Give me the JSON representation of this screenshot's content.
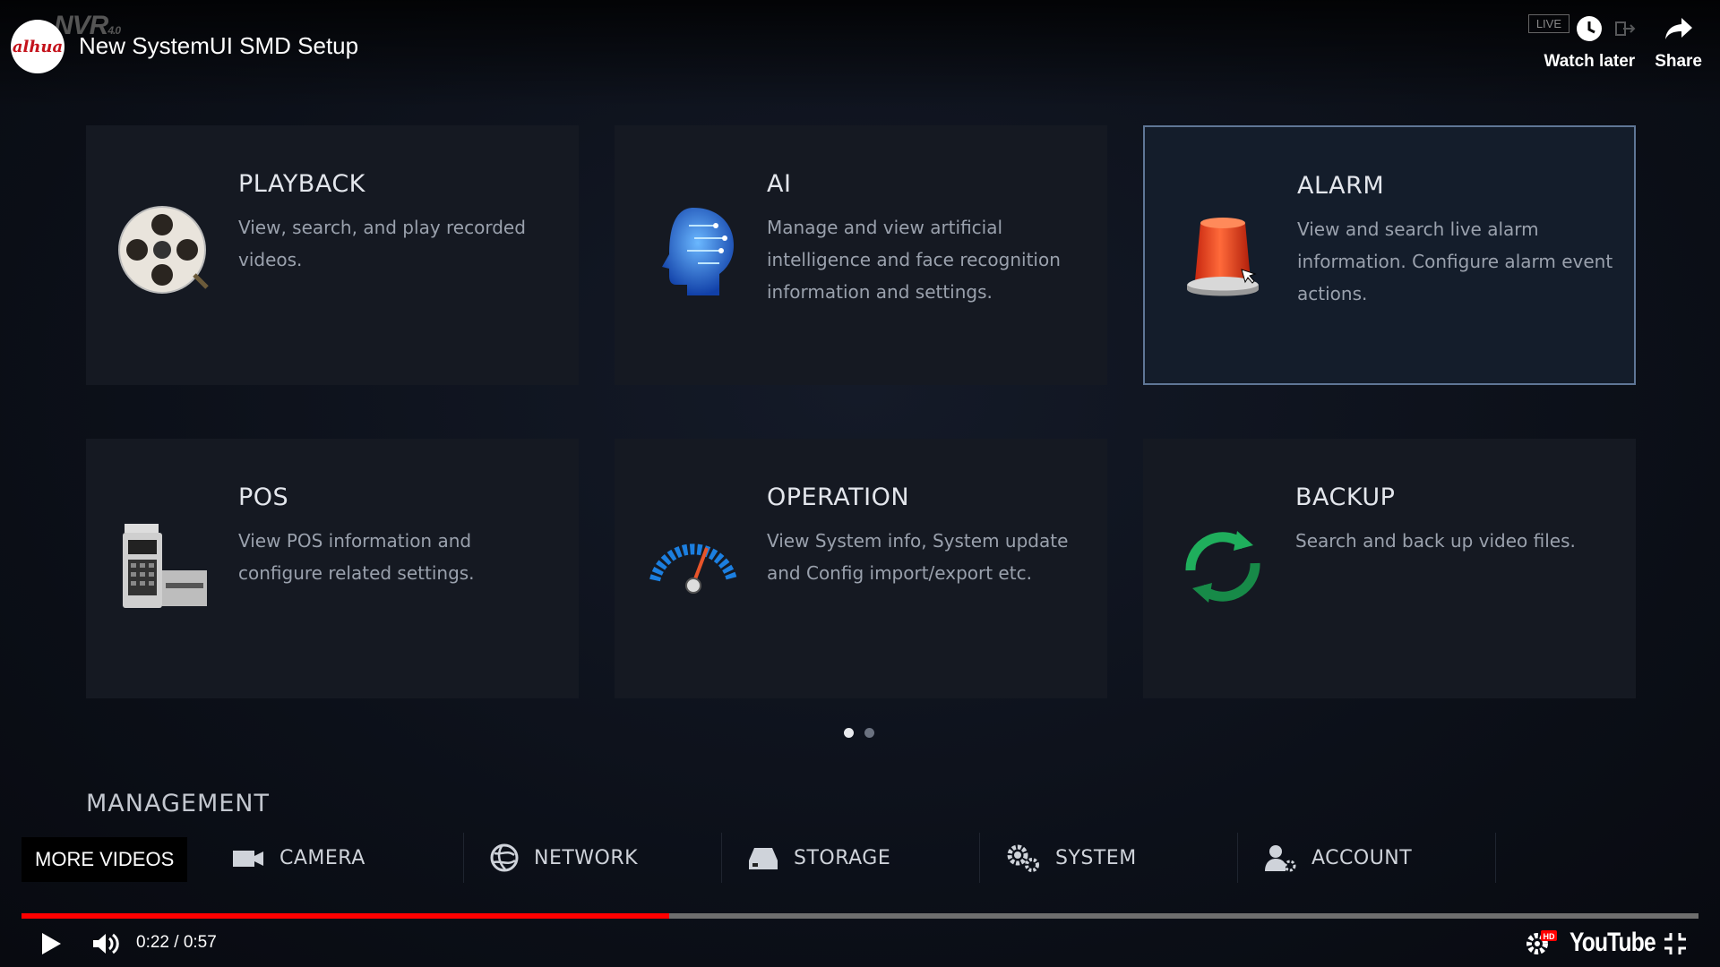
{
  "header": {
    "channel_logo_text": "alhua",
    "nvr_mark": "NVR",
    "nvr_version": "4.0",
    "title": "New SystemUI SMD Setup",
    "live_badge": "LIVE",
    "watch_later_label": "Watch later",
    "share_label": "Share"
  },
  "tiles": [
    {
      "title": "PLAYBACK",
      "desc": "View, search, and play recorded videos.",
      "icon": "film-reel-icon"
    },
    {
      "title": "AI",
      "desc": "Manage and view artificial intelligence and face recognition information and settings.",
      "icon": "ai-head-icon"
    },
    {
      "title": "ALARM",
      "desc": "View and search live alarm information. Configure alarm event actions.",
      "icon": "alarm-siren-icon",
      "selected": true
    },
    {
      "title": "POS",
      "desc": "View POS information and configure related settings.",
      "icon": "pos-terminal-icon"
    },
    {
      "title": "OPERATION",
      "desc": "View System info, System update and Config import/export etc.",
      "icon": "gauge-icon"
    },
    {
      "title": "BACKUP",
      "desc": "Search and back up video files.",
      "icon": "backup-sync-icon"
    }
  ],
  "pagination": {
    "pages": 2,
    "current": 1
  },
  "management": {
    "heading": "MANAGEMENT",
    "items": [
      {
        "label": "CAMERA",
        "icon": "camera-icon"
      },
      {
        "label": "NETWORK",
        "icon": "network-globe-icon"
      },
      {
        "label": "STORAGE",
        "icon": "storage-drive-icon"
      },
      {
        "label": "SYSTEM",
        "icon": "gears-icon"
      },
      {
        "label": "ACCOUNT",
        "icon": "account-user-icon"
      }
    ]
  },
  "player": {
    "more_videos_label": "MORE VIDEOS",
    "time": "0:22 / 0:57",
    "progress_fraction": 0.386,
    "logo_text": "YouTube",
    "hd_badge": "HD",
    "colors": {
      "progress": "#ff0000",
      "selected_border": "#5f7696"
    }
  }
}
